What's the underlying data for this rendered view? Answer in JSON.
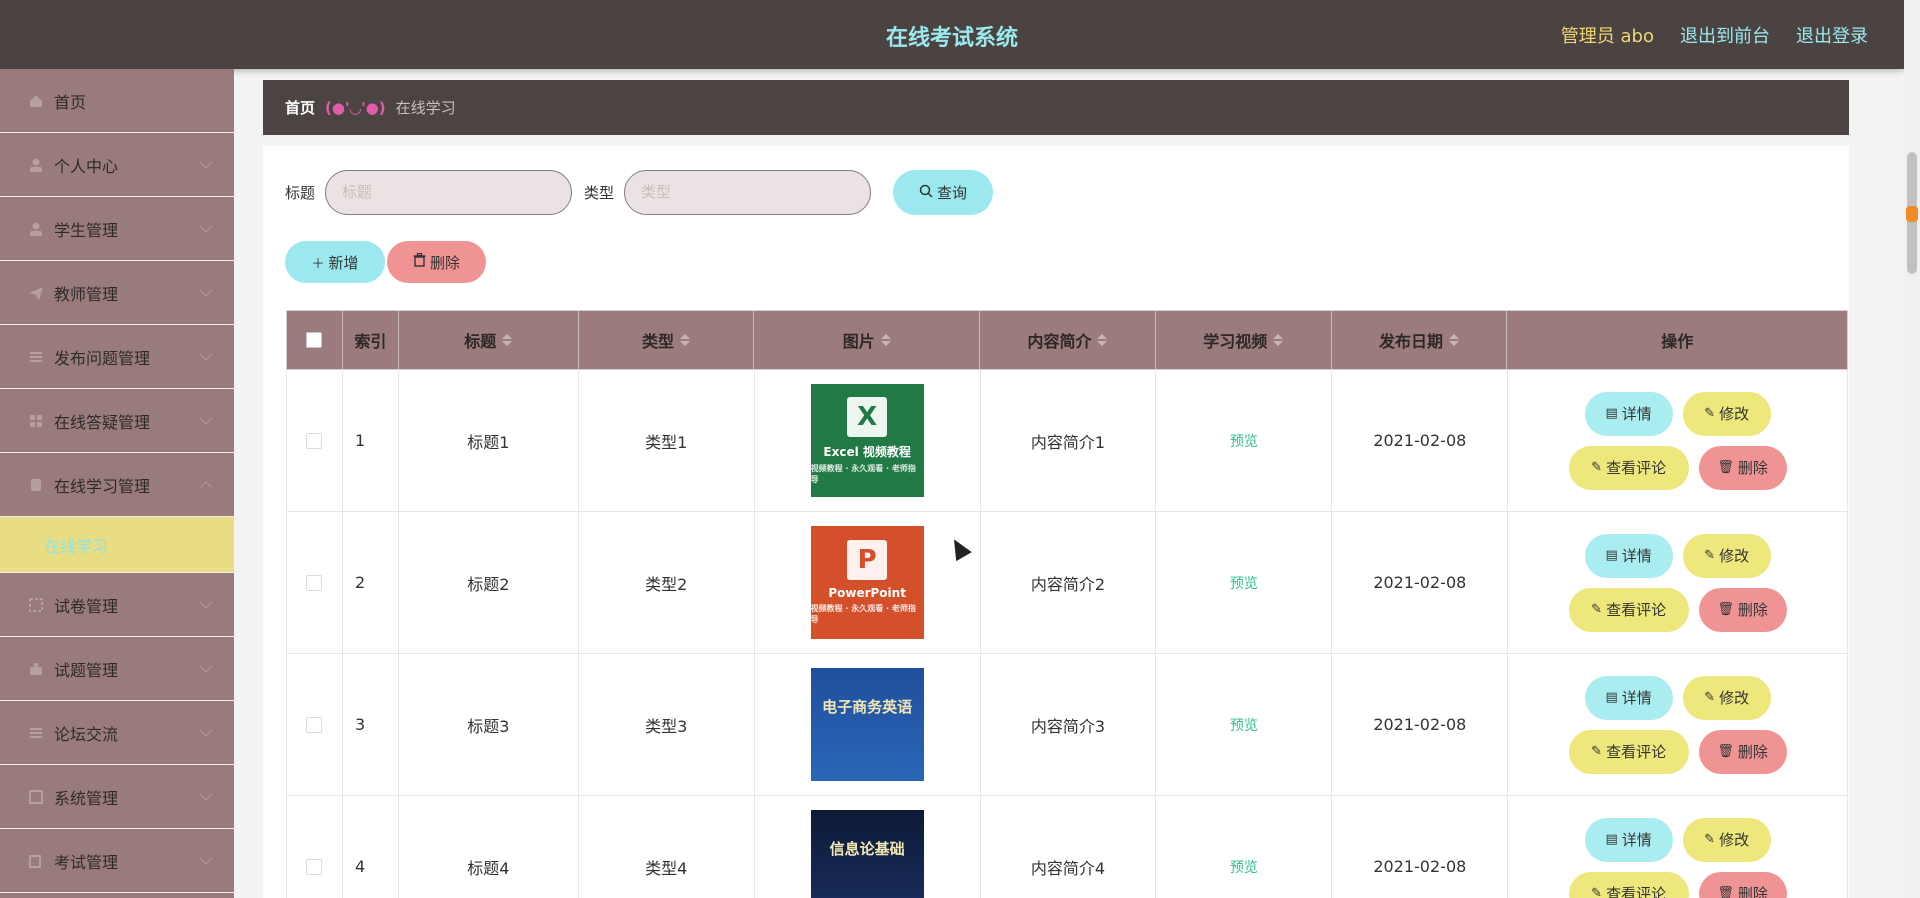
{
  "header": {
    "title": "在线考试系统",
    "user": "管理员 abo",
    "to_front": "退出到前台",
    "logout": "退出登录"
  },
  "sidebar": {
    "items": [
      {
        "label": "首页",
        "icon": "home-icon"
      },
      {
        "label": "个人中心",
        "icon": "user-icon"
      },
      {
        "label": "学生管理",
        "icon": "student-icon"
      },
      {
        "label": "教师管理",
        "icon": "send-icon"
      },
      {
        "label": "发布问题管理",
        "icon": "list-icon"
      },
      {
        "label": "在线答疑管理",
        "icon": "grid-icon"
      },
      {
        "label": "在线学习管理",
        "icon": "book-icon"
      },
      {
        "label": "试卷管理",
        "icon": "paper-icon"
      },
      {
        "label": "试题管理",
        "icon": "question-icon"
      },
      {
        "label": "论坛交流",
        "icon": "forum-icon"
      },
      {
        "label": "系统管理",
        "icon": "system-icon"
      },
      {
        "label": "考试管理",
        "icon": "exam-icon"
      }
    ],
    "active_sub": "在线学习"
  },
  "breadcrumb": {
    "home": "首页",
    "sep": "(●'◡'●)",
    "current": "在线学习"
  },
  "search": {
    "title_label": "标题",
    "title_placeholder": "标题",
    "type_label": "类型",
    "type_placeholder": "类型",
    "query": "查询"
  },
  "actions": {
    "add": "新增",
    "delete": "删除"
  },
  "table": {
    "headers": [
      "索引",
      "标题",
      "类型",
      "图片",
      "内容简介",
      "学习视频",
      "发布日期",
      "操作"
    ],
    "preview_label": "预览",
    "ops": {
      "detail": "详情",
      "edit": "修改",
      "comment": "查看评论",
      "remove": "删除"
    },
    "rows": [
      {
        "index": "1",
        "title": "标题1",
        "type": "类型1",
        "image": "Excel 视频教程",
        "image_sub": "视频教程 · 永久观看 · 老师指导",
        "intro": "内容简介1",
        "date": "2021-02-08"
      },
      {
        "index": "2",
        "title": "标题2",
        "type": "类型2",
        "image": "PowerPoint",
        "image_sub": "视频教程 · 永久观看 · 老师指导",
        "intro": "内容简介2",
        "date": "2021-02-08"
      },
      {
        "index": "3",
        "title": "标题3",
        "type": "类型3",
        "image": "电子商务英语",
        "image_sub": "",
        "intro": "内容简介3",
        "date": "2021-02-08"
      },
      {
        "index": "4",
        "title": "标题4",
        "type": "类型4",
        "image": "信息论基础",
        "image_sub": "",
        "intro": "内容简介4",
        "date": "2021-02-08"
      }
    ]
  }
}
